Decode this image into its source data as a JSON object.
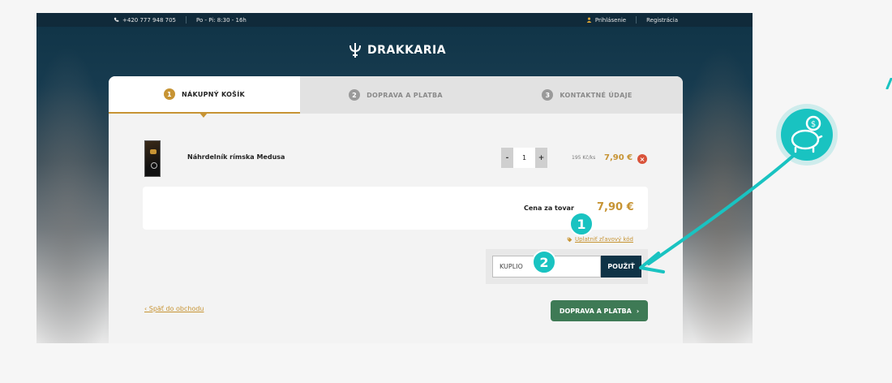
{
  "topbar": {
    "phone": "+420 777 948 705",
    "hours": "Po - Pi: 8:30 - 16h",
    "login": "Prihlásenie",
    "register": "Registrácia"
  },
  "brand": {
    "name": "DRAKKARIA"
  },
  "steps": [
    {
      "num": "1",
      "label": "NÁKUPNÝ KOŠÍK"
    },
    {
      "num": "2",
      "label": "DOPRAVA A PLATBA"
    },
    {
      "num": "3",
      "label": "KONTAKTNÉ ÚDAJE"
    }
  ],
  "cart": {
    "item": {
      "name": "Náhrdelník rímska Medusa",
      "qty": "1",
      "unit_price": "195 Kč/ks",
      "price": "7,90 €"
    },
    "qty_minus": "-",
    "qty_plus": "+",
    "remove": "×",
    "total_label": "Cena za tovar",
    "total": "7,90 €"
  },
  "coupon": {
    "link": "Uplatniť zľavový kód",
    "value": "KUPLIO",
    "button": "POUŽIŤ"
  },
  "nav": {
    "back": "‹ Späť do obchodu",
    "next": "DOPRAVA A PLATBA",
    "next_chevron": "›"
  },
  "annotations": {
    "marker1": "1",
    "marker2": "2"
  },
  "colors": {
    "accent": "#c79434",
    "dark": "#0f3346",
    "green": "#3e7a55",
    "teal": "#19c3c1"
  }
}
